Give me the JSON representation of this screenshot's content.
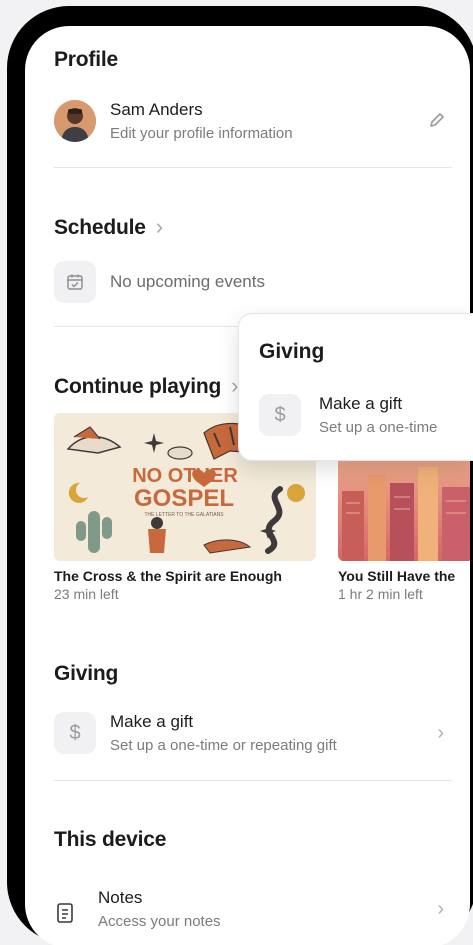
{
  "profile": {
    "heading": "Profile",
    "name": "Sam Anders",
    "subtitle": "Edit your profile information"
  },
  "schedule": {
    "heading": "Schedule",
    "chevron": "›",
    "empty_text": "No upcoming events"
  },
  "continue_playing": {
    "heading": "Continue playing",
    "chevron": "›",
    "items": [
      {
        "artwork_title": "NO OTHER",
        "artwork_title2": "GOSPEL",
        "artwork_tagline": "THE LETTER TO THE GALATIANS",
        "title": "The Cross & the Spirit are Enough",
        "time_left": "23 min left"
      },
      {
        "title": "You Still Have the",
        "time_left": "1 hr 2 min left"
      }
    ]
  },
  "giving": {
    "heading": "Giving",
    "icon": "$",
    "title": "Make a gift",
    "subtitle": "Set up a one-time or repeating gift",
    "chevron": "›"
  },
  "giving_popover": {
    "heading": "Giving",
    "icon": "$",
    "title": "Make a gift",
    "subtitle": "Set up a one-time"
  },
  "device": {
    "heading": "This device",
    "notes_title": "Notes",
    "notes_subtitle": "Access your notes",
    "chevron": "›"
  },
  "colors": {
    "accent_orange": "#c8693c",
    "artwork_bg": "#f3ead9",
    "text_primary": "#1c1c1e",
    "text_secondary": "#7b7b80"
  },
  "icons": [
    "avatar",
    "pencil-icon",
    "calendar-check-icon",
    "dollar-icon",
    "notes-icon",
    "chevron-right-icon"
  ]
}
